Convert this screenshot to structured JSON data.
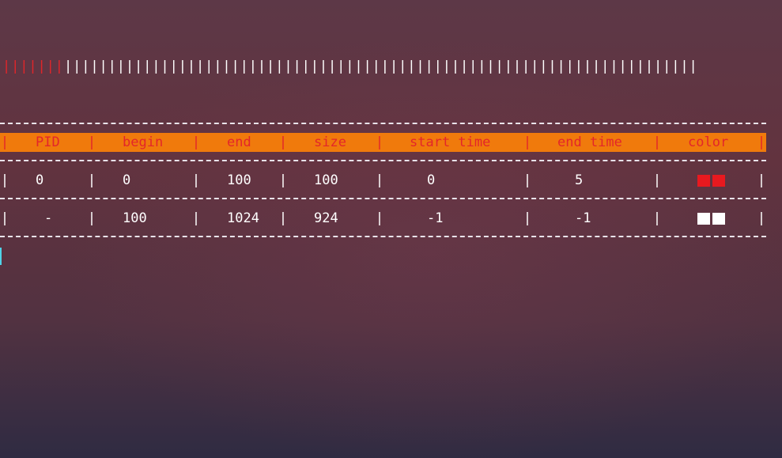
{
  "memory_bar": {
    "used_segment": "|||||||",
    "free_segment": "||||||||||||||||||||||||||||||||||||||||||||||||||||||||||||||||||||||||",
    "used_color": "#e0262a",
    "free_color": "#ffffff"
  },
  "table": {
    "separator": "|",
    "header_bg": "#f07a0c",
    "header_text_color": "#e3262a",
    "columns": [
      "PID",
      "begin",
      "end",
      "size",
      "start time",
      "end time",
      "color"
    ],
    "rows": [
      {
        "pid": "0",
        "begin": "0",
        "end": "100",
        "size": "100",
        "start_time": "0",
        "end_time": "5",
        "color": "#e8191f",
        "color_name": "red"
      },
      {
        "pid": "-",
        "begin": "100",
        "end": "1024",
        "size": "924",
        "start_time": "-1",
        "end_time": "-1",
        "color": "#ffffff",
        "color_name": "white"
      }
    ]
  },
  "cursor_color": "#4fd3e8"
}
